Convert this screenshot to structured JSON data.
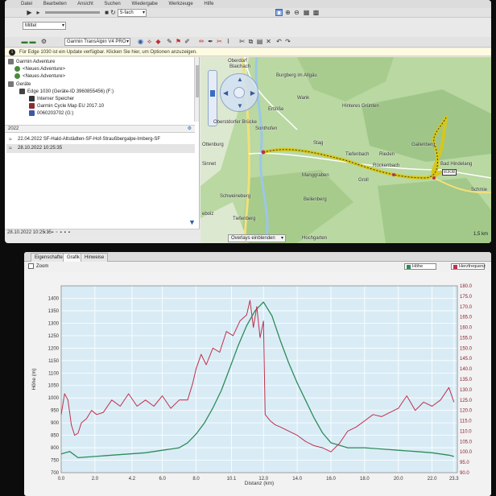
{
  "basecamp": {
    "menubar": [
      "Datei",
      "Bearbeiten",
      "Ansicht",
      "Suchen",
      "Wiedergabe",
      "Werkzeuge",
      "Hilfe"
    ],
    "speed_select": "5-fach",
    "profile_select": "Mittel",
    "map_select": "Garmin TransAlpin V4 PRO",
    "info_message": "Für Edge 1030 ist ein Update verfügbar. Klicken Sie hier, um Optionen anzuzeigen.",
    "tree": {
      "garmin_adventure": "Garmin Adventure",
      "neue1": "<Neues Adventure>",
      "neue2": "<Neues Adventure>",
      "geraete": "Geräte",
      "device": "Edge 1030 (Geräte-ID 3960855456) (F:)",
      "interner": "Interner Speicher",
      "cyclemap": "Garmin Cycle Map EU 2017.10",
      "storage": "0060203702 (G:)"
    },
    "section_title": "2022",
    "tracks": [
      "22.04.2022 SF-Hald-Altstädten-SF-Hof-Straußbergalpe-Imberg-SF",
      "28.10.2022 10:25:35"
    ],
    "status_text": "28.10.2022 10:25:35",
    "map": {
      "overlay_label": "Overlays einblenden",
      "scale_label": "1,5 km",
      "labels": [
        {
          "text": "Oberdorf",
          "key": "oberdorf"
        },
        {
          "text": "Blaichach",
          "key": "blaichach"
        },
        {
          "text": "Burgberg im Allgäu",
          "key": "burgberg"
        },
        {
          "text": "Wank",
          "key": "wank"
        },
        {
          "text": "Ertlöße",
          "key": "ertlosse"
        },
        {
          "text": "Oberstdorfer Brücke",
          "key": "brucke"
        },
        {
          "text": "Sonthofen",
          "key": "sonthofen"
        },
        {
          "text": "Stag",
          "key": "stag"
        },
        {
          "text": "Hinteres Grünten",
          "key": "grunten"
        },
        {
          "text": "Tiefenbach",
          "key": "tiefenbach"
        },
        {
          "text": "Rieden",
          "key": "rieden"
        },
        {
          "text": "Rückenbach",
          "key": "ruckenbach"
        },
        {
          "text": "Gailenberg",
          "key": "gailenberg"
        },
        {
          "text": "Bad Hindelang",
          "key": "hindelang"
        },
        {
          "text": "B308",
          "key": "b308"
        },
        {
          "text": "Manggraben",
          "key": "manggraben"
        },
        {
          "text": "Groll",
          "key": "groll"
        },
        {
          "text": "Schweineberg",
          "key": "schweineberg"
        },
        {
          "text": "Beilenberg",
          "key": "beilenberg"
        },
        {
          "text": "Tiefenberg",
          "key": "tiefenberg"
        },
        {
          "text": "Schmie",
          "key": "schmie"
        },
        {
          "text": "Hochgarten",
          "key": "hochgarten"
        },
        {
          "text": "Ottenburg",
          "key": "ottenburg"
        },
        {
          "text": "Sinnet",
          "key": "sinnet"
        },
        {
          "text": "eboiz",
          "key": "eboiz"
        }
      ]
    },
    "colors": {
      "track": "#d6c71a",
      "route_red": "#c0304a",
      "map_green": "#b9d8a2",
      "water": "#9cc7e8"
    }
  },
  "profile_window": {
    "tabs": [
      "Eigenschaften",
      "Grafik",
      "Hinweise"
    ],
    "active_tab": "Grafik",
    "zoom_label": "Zoom",
    "legend": [
      {
        "label": "Höhe",
        "color": "#2e8b57"
      },
      {
        "label": "Herzfrequenz",
        "color": "#c0304a"
      }
    ]
  },
  "chart_data": {
    "type": "line",
    "title": "",
    "xlabel": "Distanz (km)",
    "ylabel": "Höhe (m)",
    "y2label": "Herzfrequenz (bpm)",
    "xlim": [
      0,
      23.5
    ],
    "ylim": [
      700,
      1450
    ],
    "y2lim": [
      90,
      180
    ],
    "x_ticks": [
      "0.0",
      "2.0",
      "4.2",
      "6.0",
      "8.0",
      "10.1",
      "12.0",
      "14.0",
      "16.0",
      "18.0",
      "20.0",
      "22.0",
      "23.3"
    ],
    "x_tick_values": [
      0,
      2,
      4.2,
      6,
      8,
      10.1,
      12,
      14,
      16,
      18,
      20,
      22,
      23.3
    ],
    "y_ticks": [
      700,
      750,
      800,
      850,
      900,
      950,
      1000,
      1050,
      1100,
      1150,
      1200,
      1250,
      1300,
      1350,
      1400
    ],
    "y2_ticks": [
      "90.0",
      "95.0",
      "100.0",
      "105.0",
      "110.0",
      "115.0",
      "120.0",
      "125.0",
      "130.0",
      "135.0",
      "140.0",
      "145.0",
      "150.0",
      "155.0",
      "160.0",
      "165.0",
      "170.0",
      "175.0",
      "180.0"
    ],
    "y2_tick_values": [
      90,
      95,
      100,
      105,
      110,
      115,
      120,
      125,
      130,
      135,
      140,
      145,
      150,
      155,
      160,
      165,
      170,
      175,
      180
    ],
    "grid": true,
    "series": [
      {
        "name": "Höhe",
        "axis": "left",
        "color": "#2e8b57",
        "x": [
          0,
          0.5,
          1,
          2,
          3,
          4,
          5,
          6,
          7,
          7.5,
          8,
          8.5,
          9,
          9.5,
          10,
          10.5,
          11,
          11.5,
          12,
          12.5,
          13,
          13.5,
          14,
          14.5,
          15,
          15.5,
          16,
          17,
          18,
          19,
          20,
          21,
          22,
          23,
          23.3
        ],
        "values": [
          775,
          785,
          760,
          765,
          770,
          775,
          780,
          790,
          800,
          820,
          855,
          900,
          960,
          1030,
          1120,
          1210,
          1290,
          1350,
          1385,
          1330,
          1230,
          1140,
          1060,
          990,
          920,
          860,
          820,
          800,
          800,
          795,
          790,
          785,
          780,
          770,
          765
        ]
      },
      {
        "name": "Herzfrequenz",
        "axis": "right",
        "color": "#c0304a",
        "x": [
          0,
          0.2,
          0.4,
          0.6,
          0.8,
          1.0,
          1.2,
          1.5,
          1.8,
          2.1,
          2.5,
          3.0,
          3.5,
          4.0,
          4.5,
          5.0,
          5.5,
          6.0,
          6.5,
          7.0,
          7.5,
          7.8,
          8.0,
          8.3,
          8.6,
          9.0,
          9.4,
          9.8,
          10.2,
          10.6,
          11.0,
          11.2,
          11.4,
          11.6,
          11.8,
          12.0,
          12.1,
          12.2,
          12.4,
          12.7,
          13.0,
          13.5,
          14.0,
          14.5,
          15.0,
          15.5,
          16.0,
          16.5,
          17.0,
          17.5,
          18.0,
          18.5,
          19.0,
          19.5,
          20.0,
          20.5,
          21.0,
          21.5,
          22.0,
          22.5,
          23.0,
          23.3
        ],
        "values": [
          118,
          128,
          125,
          113,
          108,
          109,
          114,
          116,
          120,
          118,
          119,
          125,
          122,
          128,
          122,
          125,
          122,
          127,
          121,
          125,
          125,
          133,
          140,
          147,
          142,
          150,
          148,
          158,
          156,
          163,
          166,
          173,
          160,
          170,
          155,
          163,
          118,
          117,
          115,
          113,
          112,
          110,
          108,
          105,
          103,
          102,
          100,
          104,
          110,
          112,
          115,
          118,
          117,
          119,
          121,
          127,
          120,
          124,
          122,
          125,
          131,
          124
        ]
      }
    ]
  }
}
